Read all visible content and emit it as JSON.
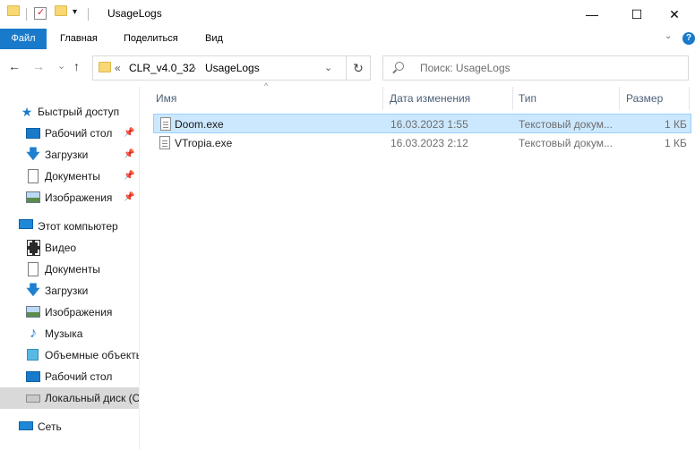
{
  "window": {
    "title": "UsageLogs",
    "controls": {
      "minimize": "—",
      "maximize": "☐",
      "close": "✕"
    }
  },
  "quick_access_toolbar": {
    "dropdown": "▾"
  },
  "ribbon": {
    "tabs": [
      "Файл",
      "Главная",
      "Поделиться",
      "Вид"
    ],
    "collapse": "⌄",
    "help": "?"
  },
  "nav": {
    "back": "←",
    "forward": "→",
    "recent": "⌄",
    "up": "↑",
    "address": {
      "overflow": "«",
      "segments": [
        "CLR_v4.0_32",
        "UsageLogs"
      ],
      "separator": "›",
      "dropdown": "⌄"
    },
    "refresh": "↻",
    "search_placeholder": "Поиск: UsageLogs"
  },
  "sidebar": {
    "items": [
      {
        "label": "Быстрый доступ",
        "icon": "star-icon",
        "pinned": false
      },
      {
        "label": "Рабочий стол",
        "icon": "desktop-icon",
        "pinned": true
      },
      {
        "label": "Загрузки",
        "icon": "downloads-icon",
        "pinned": true
      },
      {
        "label": "Документы",
        "icon": "documents-icon",
        "pinned": true
      },
      {
        "label": "Изображения",
        "icon": "pictures-icon",
        "pinned": true
      },
      {
        "label": "Этот компьютер",
        "icon": "this-pc-icon",
        "pinned": false
      },
      {
        "label": "Видео",
        "icon": "videos-icon",
        "pinned": false
      },
      {
        "label": "Документы",
        "icon": "documents-icon",
        "pinned": false
      },
      {
        "label": "Загрузки",
        "icon": "downloads-icon",
        "pinned": false
      },
      {
        "label": "Изображения",
        "icon": "pictures-icon",
        "pinned": false
      },
      {
        "label": "Музыка",
        "icon": "music-icon",
        "pinned": false
      },
      {
        "label": "Объемные объекты",
        "icon": "3d-objects-icon",
        "pinned": false
      },
      {
        "label": "Рабочий стол",
        "icon": "desktop-icon",
        "pinned": false
      },
      {
        "label": "Локальный диск (C",
        "icon": "local-disk-icon",
        "pinned": false,
        "selected": true
      },
      {
        "label": "Сеть",
        "icon": "network-icon",
        "pinned": false
      }
    ],
    "pin_glyph": "📌"
  },
  "file_list": {
    "columns": {
      "name": "Имя",
      "date": "Дата изменения",
      "type": "Тип",
      "size": "Размер"
    },
    "sort_indicator": "^",
    "rows": [
      {
        "name": "Doom.exe",
        "date": "16.03.2023 1:55",
        "type": "Текстовый докум...",
        "size": "1 КБ",
        "selected": true
      },
      {
        "name": "VTropia.exe",
        "date": "16.03.2023 2:12",
        "type": "Текстовый докум...",
        "size": "1 КБ",
        "selected": false
      }
    ]
  },
  "colors": {
    "accent": "#1979ca",
    "selection": "#cce8ff",
    "selection_border": "#99d1ff",
    "sidebar_selected": "#d9d9d9",
    "header_text": "#4c607a"
  }
}
